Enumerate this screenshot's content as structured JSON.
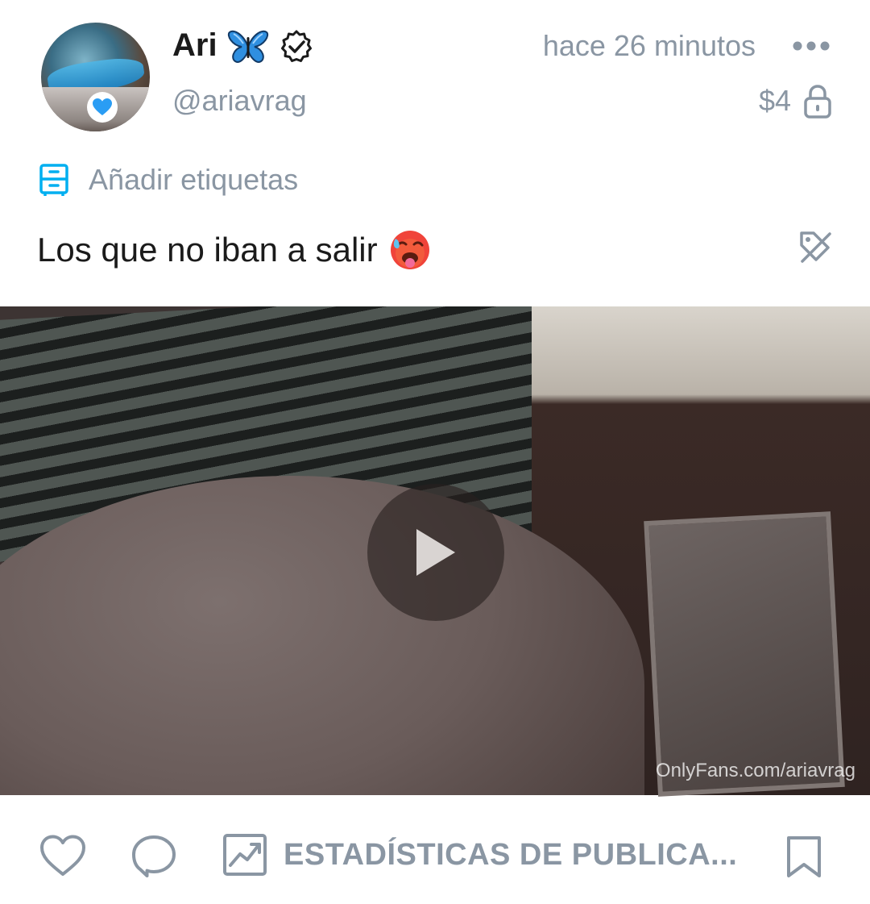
{
  "post": {
    "author": {
      "display_name": "Ari",
      "name_emoji": "butterfly",
      "verified": true,
      "username": "@ariavrag",
      "avatar_badge": "blue-heart"
    },
    "timestamp": "hace 26 minutos",
    "price": "$4",
    "tags_label": "Añadir etiquetas",
    "caption": "Los que no iban a salir",
    "caption_emoji": "hot-face",
    "media": {
      "type": "video",
      "watermark": "OnlyFans.com/ariavrag"
    },
    "actions": {
      "stats_label": "ESTADÍSTICAS DE PUBLICA..."
    }
  },
  "icons": {
    "more": "more-dots-icon",
    "lock": "lock-icon",
    "tags": "tag-drawer-icon",
    "tag_off": "tag-off-icon",
    "play": "play-icon",
    "like": "heart-icon",
    "comment": "comment-icon",
    "stats": "chart-icon",
    "bookmark": "bookmark-icon"
  },
  "colors": {
    "text_primary": "#1b1b1b",
    "text_secondary": "#8a96a3",
    "accent_blue": "#00aff0",
    "background": "#ffffff"
  }
}
